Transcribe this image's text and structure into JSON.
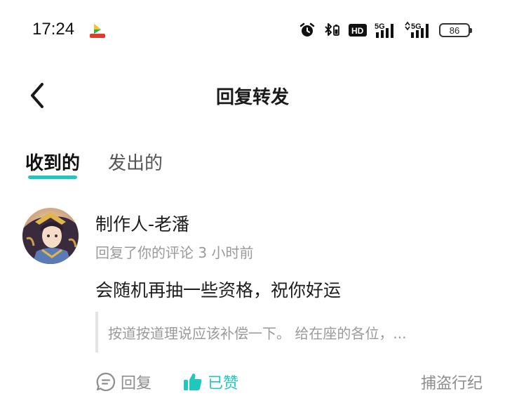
{
  "status_bar": {
    "time": "17:24",
    "battery": "86",
    "network_1": "5G",
    "network_2": "5G",
    "hd_label": "HD"
  },
  "header": {
    "title": "回复转发",
    "back_icon": "chevron-left-icon"
  },
  "tabs": [
    {
      "label": "收到的",
      "active": true
    },
    {
      "label": "发出的",
      "active": false
    }
  ],
  "notification": {
    "author": "制作人-老潘",
    "meta": "回复了你的评论 3 小时前",
    "reply_text": "会随机再抽一些资格，祝你好运",
    "quoted_comment": "按道按道理说应该补偿一下。 给在座的各位，...",
    "actions": {
      "reply_label": "回复",
      "liked_label": "已赞",
      "report_label": "捕盗行纪"
    }
  },
  "colors": {
    "accent": "#20c7bd",
    "muted_text": "#9a9a9a",
    "primary_text": "#1c1c1c"
  }
}
